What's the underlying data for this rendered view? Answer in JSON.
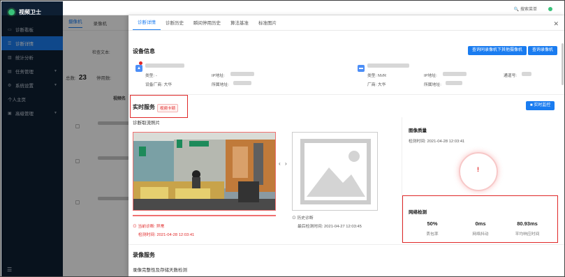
{
  "app": {
    "title": "视频卫士",
    "search_text": "搜索菜单"
  },
  "sidebar": {
    "items": [
      {
        "label": "诊断看板",
        "icon": "monitor-icon",
        "active": false,
        "expandable": false
      },
      {
        "label": "诊断详情",
        "icon": "list-icon",
        "active": true,
        "expandable": false
      },
      {
        "label": "统计分析",
        "icon": "chart-icon",
        "active": false,
        "expandable": false
      },
      {
        "label": "任务管理",
        "icon": "task-icon",
        "active": false,
        "expandable": true
      },
      {
        "label": "系统设置",
        "icon": "gear-icon",
        "active": false,
        "expandable": true
      },
      {
        "label": "个人主页",
        "icon": "",
        "active": false,
        "expandable": false
      },
      {
        "label": "高级管理",
        "icon": "admin-icon",
        "active": false,
        "expandable": true
      }
    ]
  },
  "background": {
    "tabs": [
      "摄像机",
      "录像机"
    ],
    "search_label": "检查文本:",
    "total_label": "总数:",
    "total_value": "23",
    "sort_label": "停用数:",
    "column_header": "视频名"
  },
  "drawer": {
    "tabs": [
      "诊断详情",
      "诊断历史",
      "瞬间停用历史",
      "算法基准",
      "标准图片"
    ],
    "device_info": {
      "title": "设备信息",
      "btn_query_camera": "查询同录像机下其他摄像机",
      "btn_query_recorder": "查询录像机",
      "camera": {
        "type_label": "类型:",
        "type_value": "-",
        "vendor_label": "设备厂商:",
        "vendor_value": "大华",
        "ip_label": "IP地址:",
        "location_label": "所属地址:"
      },
      "recorder": {
        "type_label": "类型:",
        "type_value": "NVR",
        "vendor_label": "厂商:",
        "vendor_value": "大华",
        "ip_label": "IP地址:",
        "location_label": "所属地址:",
        "channel_label": "通道号:"
      }
    },
    "realtime": {
      "title": "实时服务",
      "tag": "视频卡顿",
      "btn_monitor": "实时监控",
      "snapshot_title": "诊断取流照片",
      "current_result_label": "当前诊断:",
      "current_result_value": "异常",
      "check_time_label": "检测时间:",
      "check_time_value": "2021-04-28 12:03:41",
      "history_label": "历史诊断",
      "history_time_label": "最后检测时间:",
      "history_time_value": "2021-04-27 12:03:45"
    },
    "image_quality": {
      "title": "图像质量",
      "check_time_label": "检测时间:",
      "check_time_value": "2021-04-28 12:03:41",
      "gauge_value": "!"
    },
    "network": {
      "title": "网络检测",
      "metrics": [
        {
          "value": "50%",
          "label": "丢包率"
        },
        {
          "value": "0ms",
          "label": "网络抖动"
        },
        {
          "value": "80.93ms",
          "label": "平均响应时间"
        }
      ]
    },
    "recording": {
      "title": "录像服务",
      "subtitle": "录像完整性及存储天数检测"
    }
  },
  "colors": {
    "accent": "#1a7cf0",
    "sidebar": "#0e1f33",
    "alert": "#e02828"
  }
}
